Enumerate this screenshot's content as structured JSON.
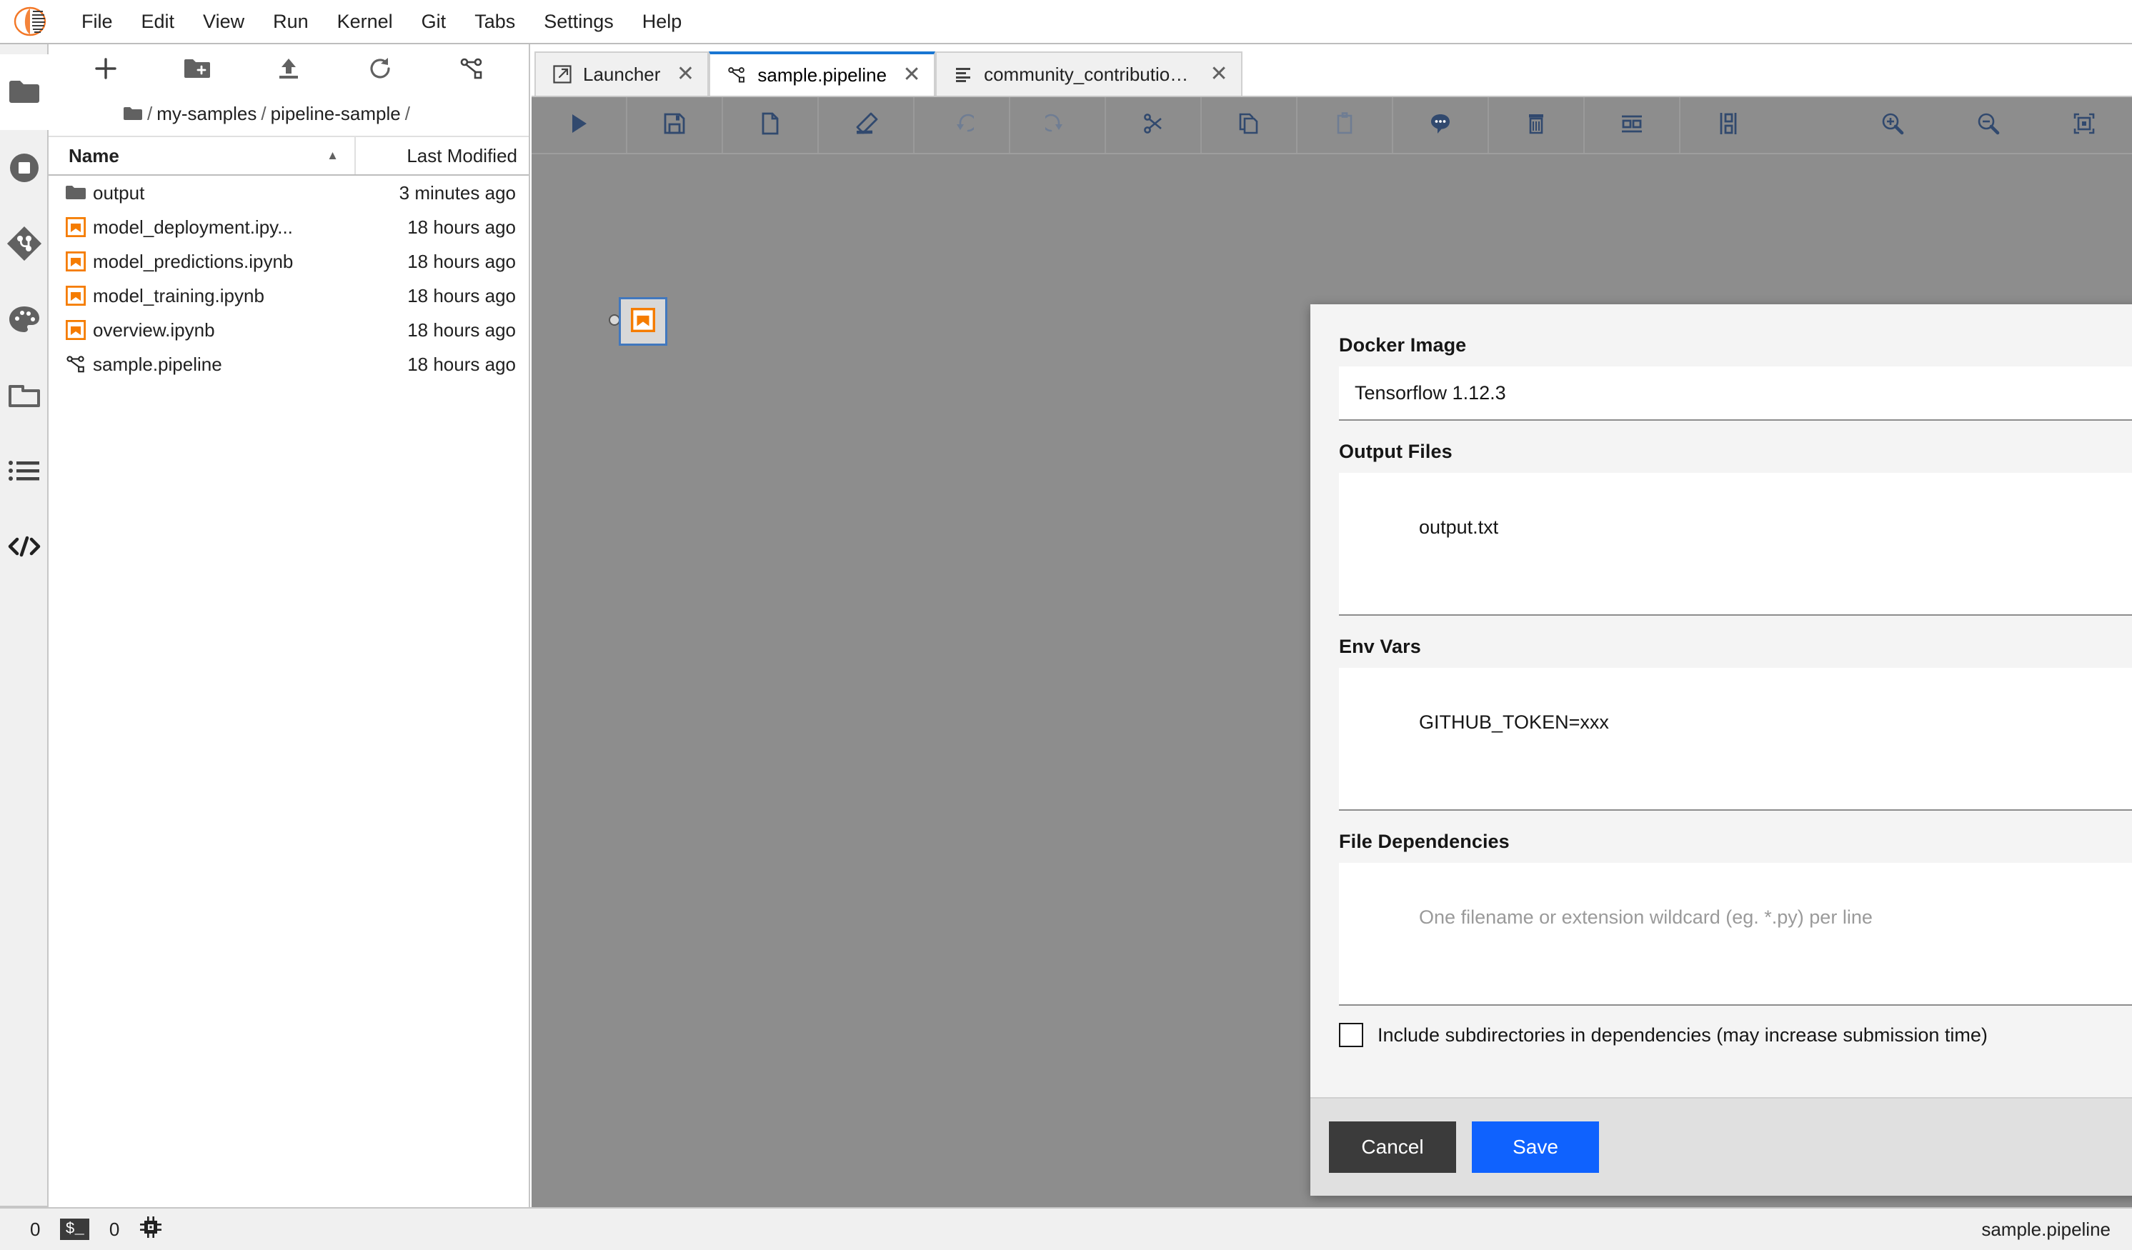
{
  "app": {
    "logo_icon": "jupyter-logo-icon"
  },
  "menubar": {
    "items": [
      {
        "label": "File"
      },
      {
        "label": "Edit"
      },
      {
        "label": "View"
      },
      {
        "label": "Run"
      },
      {
        "label": "Kernel"
      },
      {
        "label": "Git"
      },
      {
        "label": "Tabs"
      },
      {
        "label": "Settings"
      },
      {
        "label": "Help"
      }
    ]
  },
  "activitybar": {
    "items": [
      {
        "name": "file-browser",
        "icon": "folder-icon",
        "selected": true
      },
      {
        "name": "running-terminals-kernels",
        "icon": "stop-circle-icon",
        "selected": false
      },
      {
        "name": "git",
        "icon": "git-branch-icon",
        "selected": false
      },
      {
        "name": "extension-manager",
        "icon": "palette-icon",
        "selected": false
      },
      {
        "name": "open-tabs",
        "icon": "tab-folder-icon",
        "selected": false
      },
      {
        "name": "table-of-contents",
        "icon": "list-icon",
        "selected": false
      },
      {
        "name": "code-snippets",
        "icon": "code-icon",
        "selected": false
      }
    ]
  },
  "filebrowser": {
    "toolbar": [
      {
        "name": "new-launcher",
        "icon": "plus-icon"
      },
      {
        "name": "new-folder",
        "icon": "folder-plus-icon"
      },
      {
        "name": "upload-files",
        "icon": "upload-icon"
      },
      {
        "name": "refresh-file-list",
        "icon": "refresh-icon"
      },
      {
        "name": "new-pipeline",
        "icon": "pipeline-icon"
      }
    ],
    "breadcrumb": {
      "root_icon": "folder-icon",
      "parts": [
        "my-samples",
        "pipeline-sample"
      ]
    },
    "columns": {
      "name": "Name",
      "last_modified": "Last Modified",
      "sort_caret": "▲"
    },
    "rows": [
      {
        "icon": "folder-icon",
        "name": "output",
        "modified": "3 minutes ago"
      },
      {
        "icon": "notebook-icon",
        "name": "model_deployment.ipy...",
        "modified": "18 hours ago"
      },
      {
        "icon": "notebook-icon",
        "name": "model_predictions.ipynb",
        "modified": "18 hours ago"
      },
      {
        "icon": "notebook-icon",
        "name": "model_training.ipynb",
        "modified": "18 hours ago"
      },
      {
        "icon": "notebook-icon",
        "name": "overview.ipynb",
        "modified": "18 hours ago"
      },
      {
        "icon": "pipeline-icon",
        "name": "sample.pipeline",
        "modified": "18 hours ago"
      }
    ]
  },
  "tabs": [
    {
      "label": "Launcher",
      "icon": "launcher-icon",
      "active": false,
      "close": "✕"
    },
    {
      "label": "sample.pipeline",
      "icon": "pipeline-icon",
      "active": true,
      "close": "✕"
    },
    {
      "label": "community_contributions.(",
      "icon": "text-file-icon",
      "active": false,
      "close": "✕"
    }
  ],
  "pipeline_toolbar": [
    {
      "name": "run-pipeline",
      "icon": "play-icon",
      "disabled": false
    },
    {
      "name": "save-pipeline",
      "icon": "save-icon",
      "disabled": false
    },
    {
      "name": "export-pipeline",
      "icon": "file-icon",
      "disabled": false
    },
    {
      "name": "clear-pipeline",
      "icon": "eraser-icon",
      "disabled": false
    },
    {
      "name": "undo",
      "icon": "undo-icon",
      "disabled": true
    },
    {
      "name": "redo",
      "icon": "redo-icon",
      "disabled": true
    },
    {
      "name": "cut",
      "icon": "scissors-icon",
      "disabled": false
    },
    {
      "name": "copy",
      "icon": "copy-icon",
      "disabled": false
    },
    {
      "name": "paste",
      "icon": "clipboard-icon",
      "disabled": true
    },
    {
      "name": "add-comment",
      "icon": "comment-icon",
      "disabled": false
    },
    {
      "name": "delete",
      "icon": "trash-icon",
      "disabled": false
    },
    {
      "name": "arrange-horizontally",
      "icon": "arrange-horizontal-icon",
      "disabled": false
    },
    {
      "name": "arrange-vertically",
      "icon": "arrange-vertical-icon",
      "disabled": false
    },
    {
      "name": "zoom-in",
      "icon": "zoom-in-icon",
      "disabled": false
    },
    {
      "name": "zoom-out",
      "icon": "zoom-out-icon",
      "disabled": false
    },
    {
      "name": "fit-to-screen",
      "icon": "fit-screen-icon",
      "disabled": false
    }
  ],
  "canvas": {
    "node": {
      "icon": "notebook-icon"
    }
  },
  "dialog": {
    "docker_image": {
      "label": "Docker Image",
      "value": "Tensorflow 1.12.3",
      "caret_icon": "chevron-down-icon"
    },
    "output_files": {
      "label": "Output Files",
      "value": "output.txt",
      "placeholder": ""
    },
    "env_vars": {
      "label": "Env Vars",
      "value": "GITHUB_TOKEN=xxx",
      "placeholder": ""
    },
    "file_dependencies": {
      "label": "File Dependencies",
      "value": "",
      "placeholder": "One filename or extension wildcard (eg. *.py) per line"
    },
    "include_subdirectories": {
      "label": "Include subdirectories in dependencies (may increase submission time)",
      "checked": false
    },
    "cancel_label": "Cancel",
    "save_label": "Save"
  },
  "statusbar": {
    "kernel_count": "0",
    "terminal_badge": "$_",
    "terminal_count": "0",
    "resource_icon": "cpu-chip-icon",
    "current_file": "sample.pipeline"
  },
  "colors": {
    "accent_blue": "#0f62fe",
    "tab_active_border": "#1976d2",
    "notebook_orange": "#f57c00",
    "cancel_dark": "#3b3b3b",
    "canvas_gray": "#8d8d8d",
    "toolbar_icon": "#31496e"
  }
}
